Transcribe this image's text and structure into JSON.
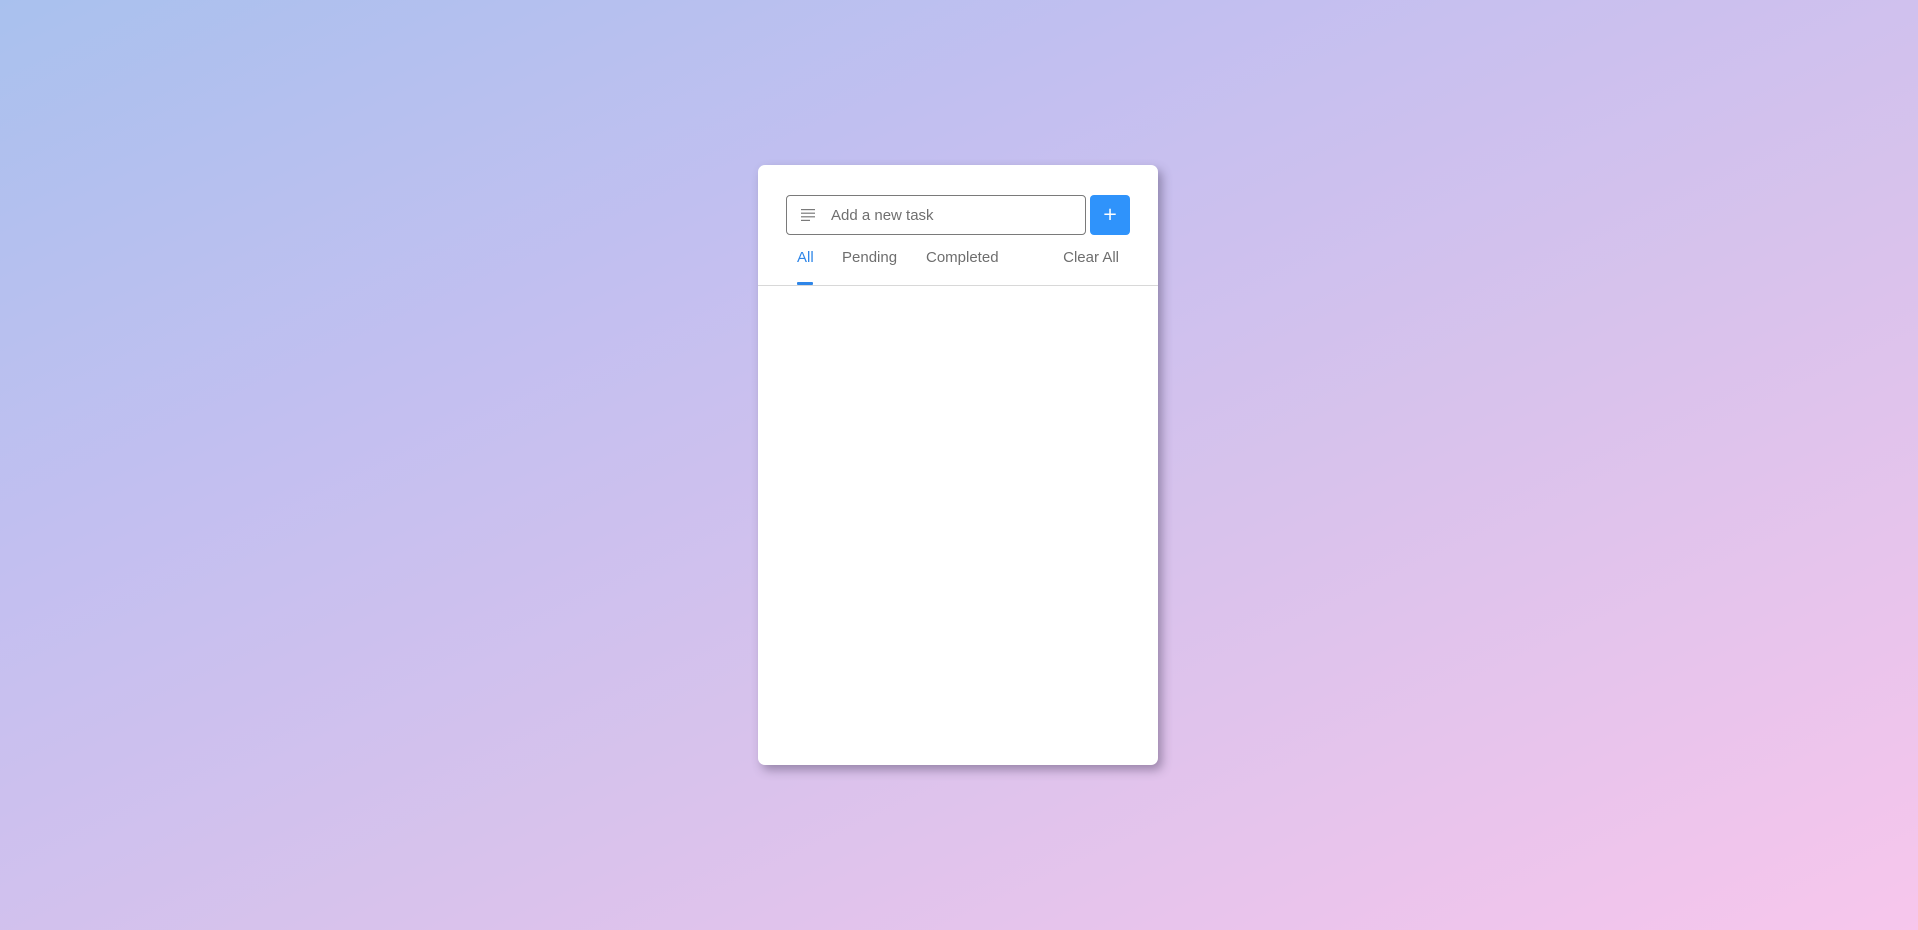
{
  "input": {
    "value": "",
    "placeholder": "Add a new task",
    "icon": "menu-lines-icon"
  },
  "add_button": {
    "label": "+"
  },
  "filters": {
    "tabs": [
      {
        "label": "All",
        "active": true
      },
      {
        "label": "Pending",
        "active": false
      },
      {
        "label": "Completed",
        "active": false
      }
    ],
    "clear_label": "Clear All"
  },
  "tasks": [],
  "colors": {
    "accent": "#2f93fb",
    "active_tab": "#2f86e8",
    "tab_text": "#6e6e6e"
  }
}
